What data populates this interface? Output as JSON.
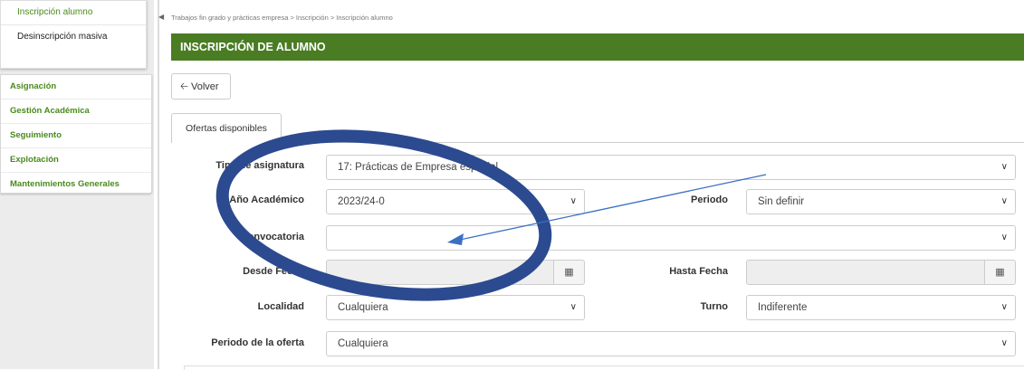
{
  "sidebar": {
    "submenu": [
      "Inscripción alumno",
      "Desinscripción masiva"
    ],
    "menu": [
      "Asignación",
      "Gestión Académica",
      "Seguimiento",
      "Explotación",
      "Mantenimientos Generales"
    ]
  },
  "breadcrumb": "Trabajos fin grado y prácticas empresa > Inscripción > Inscripción alumno",
  "header": {
    "title": "INSCRIPCIÓN DE ALUMNO"
  },
  "back_button": "Volver",
  "tab": "Ofertas disponibles",
  "form": {
    "tipo_asignatura": {
      "label": "Tipo de asignatura",
      "value": "17: Prácticas de Empresa especial"
    },
    "anio_academico": {
      "label": "Año Académico",
      "value": "2023/24-0"
    },
    "periodo": {
      "label": "Periodo",
      "value": "Sin definir"
    },
    "convocatoria": {
      "label": "Convocatoria",
      "value": ""
    },
    "desde_fecha": {
      "label": "Desde Fecha",
      "value": ""
    },
    "hasta_fecha": {
      "label": "Hasta Fecha",
      "value": ""
    },
    "localidad": {
      "label": "Localidad",
      "value": "Cualquiera"
    },
    "turno": {
      "label": "Turno",
      "value": "Indiferente"
    },
    "periodo_oferta": {
      "label": "Periodo de la oferta",
      "value": "Cualquiera"
    }
  },
  "icons": {
    "chevron": "chevron-down-icon",
    "calendar": "calendar-icon",
    "back": "arrow-left-icon",
    "collapse": "caret-left-icon"
  },
  "colors": {
    "accent": "#4a7c23",
    "link": "#4a8a1e",
    "annotation": "#2c4a8f"
  }
}
